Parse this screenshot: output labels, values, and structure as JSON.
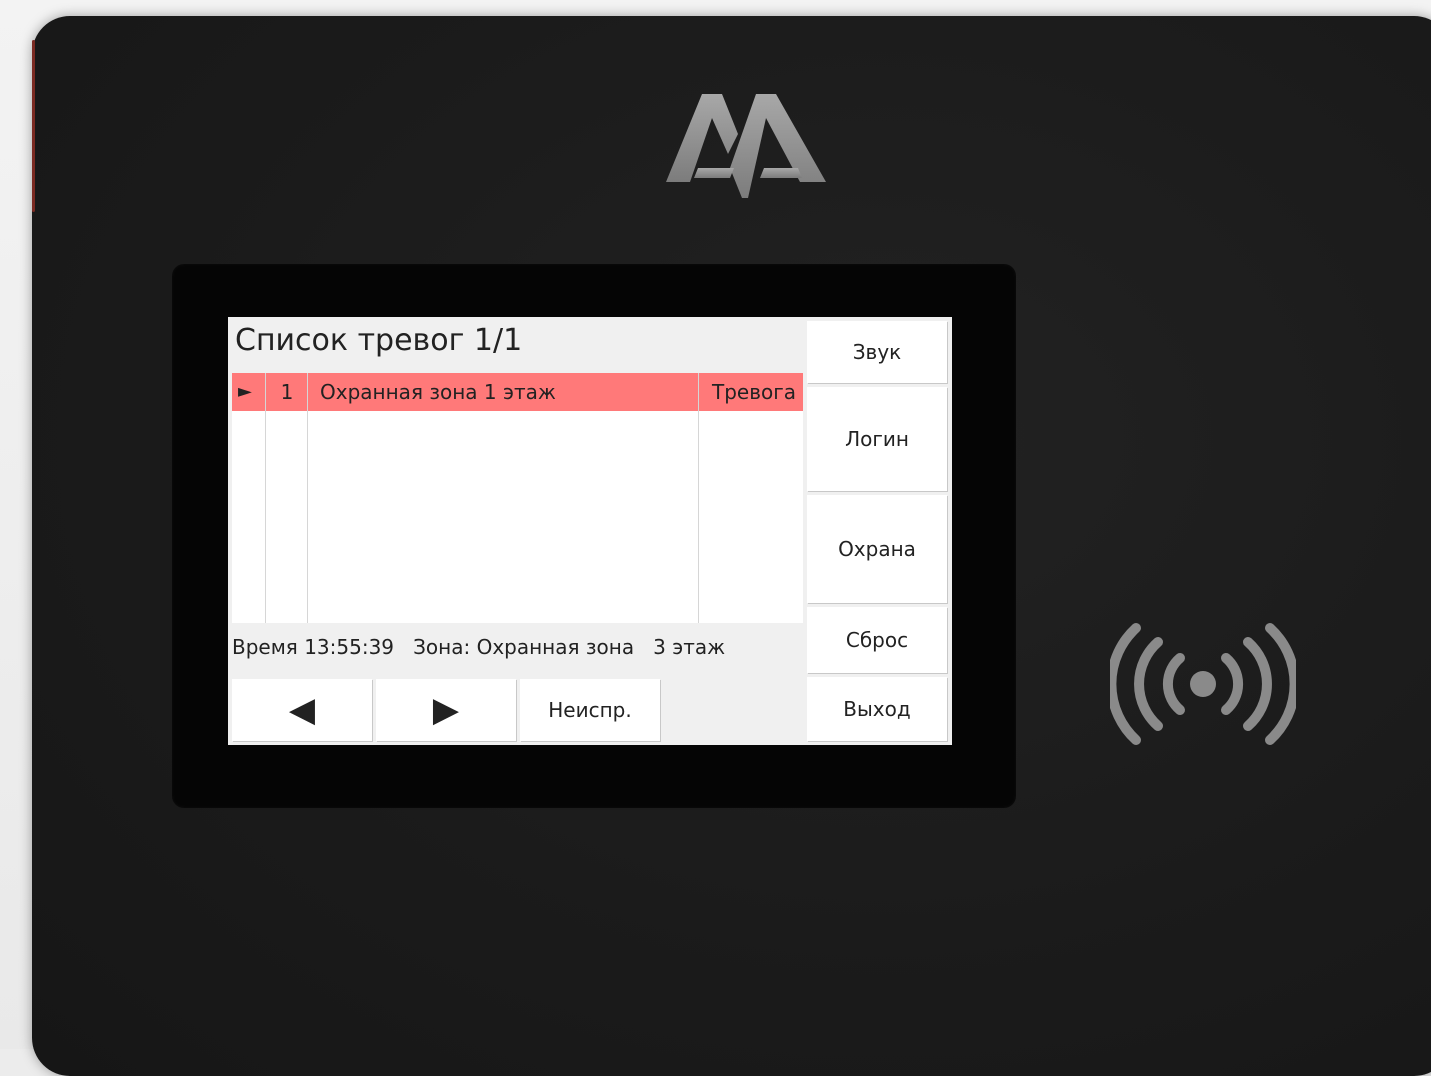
{
  "device": {
    "logo_text": "AA",
    "logo_color": "#9a9a9a",
    "rfid_icon": "contactless-wave-icon",
    "rfid_color": "#8a8a8a"
  },
  "screen": {
    "title": "Список тревог 1/1",
    "alarm_rows": [
      {
        "marker": "►",
        "number": "1",
        "zone": "Охранная зона 1 этаж",
        "status": "Тревога",
        "highlight_color": "#ff7979"
      }
    ],
    "info_line": "Время 13:55:39   Зона: Охранная зона   3 этаж",
    "bottom_buttons": {
      "prev": "◀",
      "next": "▶",
      "faulty": "Неиспр."
    },
    "side_buttons": {
      "sound": "Звук",
      "login": "Логин",
      "guard": "Охрана",
      "reset": "Сброс",
      "exit": "Выход"
    }
  }
}
